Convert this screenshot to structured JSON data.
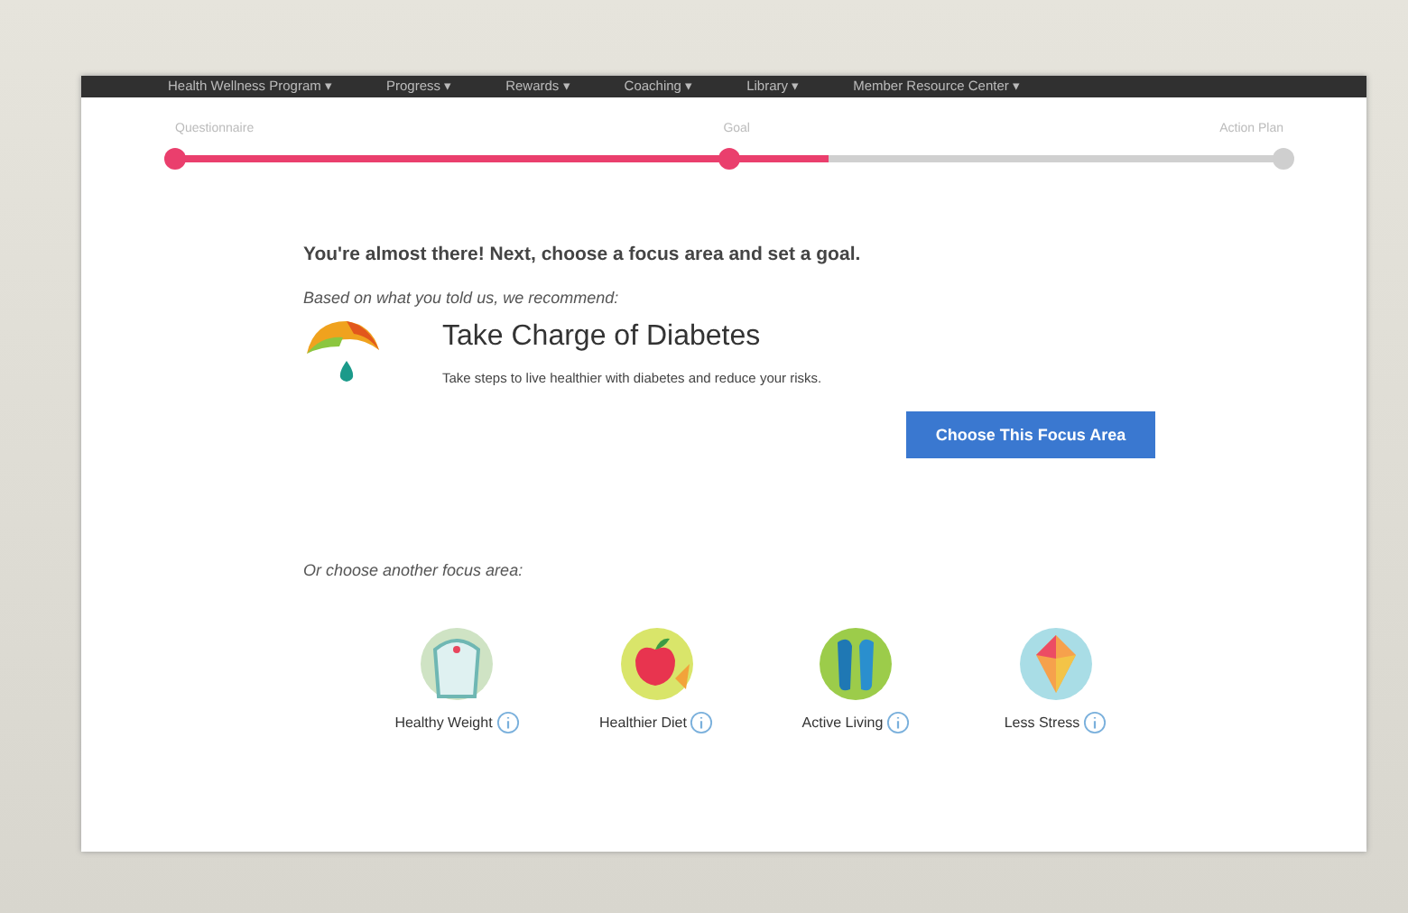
{
  "nav": {
    "items": [
      {
        "label": "Health Wellness Program ▾"
      },
      {
        "label": "Progress ▾"
      },
      {
        "label": "Rewards ▾"
      },
      {
        "label": "Coaching ▾"
      },
      {
        "label": "Library ▾"
      },
      {
        "label": "Member Resource Center ▾"
      }
    ]
  },
  "progress": {
    "steps": [
      {
        "label": "Questionnaire",
        "done": true
      },
      {
        "label": "Goal",
        "done": true
      },
      {
        "label": "Action Plan",
        "done": false
      }
    ],
    "level": 0.59
  },
  "intro": "You're almost there! Next, choose a focus area and set a goal.",
  "recommend_label": "Based on what you told us, we recommend:",
  "recommendation": {
    "title": "Take Charge of Diabetes",
    "description": "Take steps to live healthier with diabetes and reduce your risks.",
    "button": "Choose This Focus Area"
  },
  "other_label": "Or choose another focus area:",
  "focus_areas": [
    {
      "label": "Healthy Weight",
      "kind": "scale"
    },
    {
      "label": "Healthier Diet",
      "kind": "apple"
    },
    {
      "label": "Active Living",
      "kind": "shoes"
    },
    {
      "label": "Less Stress",
      "kind": "kite"
    }
  ]
}
